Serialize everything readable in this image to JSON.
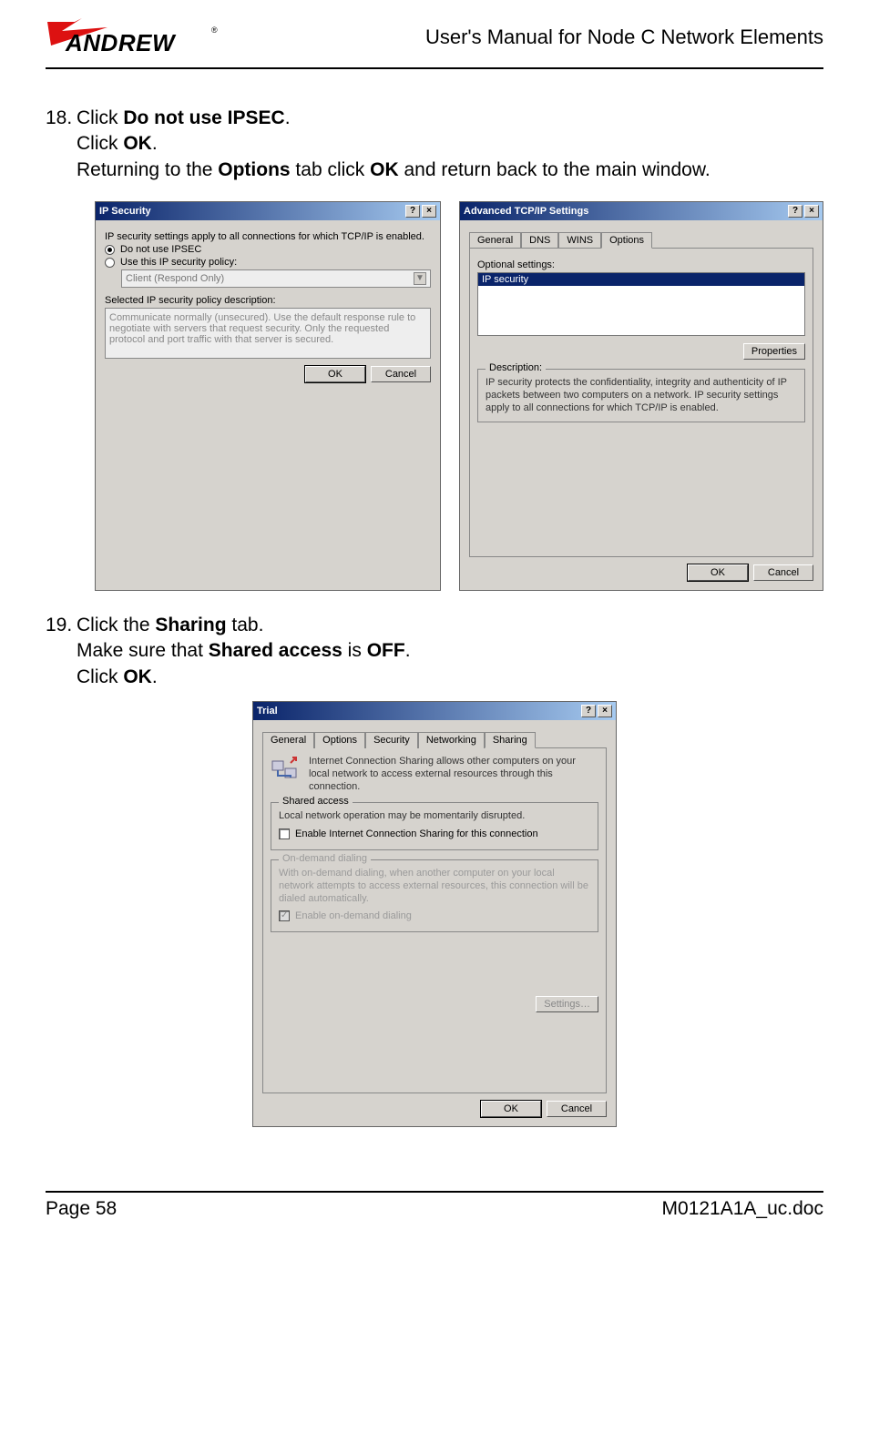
{
  "header": {
    "logo_text": "ANDREW",
    "manual_title": "User's Manual for Node C Network Elements"
  },
  "steps": {
    "s18": {
      "num": "18.",
      "l1a": "Click ",
      "l1b": "Do not use IPSEC",
      "l1c": ".",
      "l2a": "Click ",
      "l2b": "OK",
      "l2c": ".",
      "l3a": "Returning to the ",
      "l3b": "Options",
      "l3c": " tab click ",
      "l3d": "OK",
      "l3e": " and return back to the main window."
    },
    "s19": {
      "num": "19.",
      "l1a": "Click the ",
      "l1b": "Sharing",
      "l1c": " tab.",
      "l2a": "Make sure that ",
      "l2b": "Shared access",
      "l2c": " is ",
      "l2d": "OFF",
      "l2e": ".",
      "l3a": "Click ",
      "l3b": "OK",
      "l3c": "."
    }
  },
  "dlg_ipsec": {
    "title": "IP Security",
    "intro": "IP security settings apply to all connections for which TCP/IP is enabled.",
    "r1": "Do not use IPSEC",
    "r2": "Use this IP security policy:",
    "dd": "Client (Respond Only)",
    "pol_label": "Selected IP security policy description:",
    "pol_desc": "Communicate normally (unsecured). Use the default response rule to negotiate with servers that request security. Only the requested protocol and port traffic with that server is secured.",
    "ok": "OK",
    "cancel": "Cancel"
  },
  "dlg_adv": {
    "title": "Advanced TCP/IP Settings",
    "tabs": {
      "general": "General",
      "dns": "DNS",
      "wins": "WINS",
      "options": "Options"
    },
    "opt_label": "Optional settings:",
    "opt_item": "IP security",
    "props_btn": "Properties",
    "desc_title": "Description:",
    "desc_text": "IP security protects the confidentiality, integrity and authenticity of IP packets between two computers on a network. IP security settings apply to all connections for which TCP/IP is enabled.",
    "ok": "OK",
    "cancel": "Cancel"
  },
  "dlg_trial": {
    "title": "Trial",
    "tabs": {
      "general": "General",
      "options": "Options",
      "security": "Security",
      "networking": "Networking",
      "sharing": "Sharing"
    },
    "info": "Internet Connection Sharing allows other computers on your local network to access external resources through this connection.",
    "grp_shared": "Shared access",
    "shared_line": "Local network operation may be momentarily disrupted.",
    "chk_enable": "Enable Internet Connection Sharing for this connection",
    "grp_od": "On-demand dialing",
    "od_text": "With on-demand dialing, when another computer on your local network attempts to access external resources, this connection will be dialed automatically.",
    "chk_od": "Enable on-demand dialing",
    "settings_btn": "Settings…",
    "ok": "OK",
    "cancel": "Cancel"
  },
  "footer": {
    "page": "Page 58",
    "doc": "M0121A1A_uc.doc"
  },
  "glyph": {
    "help": "?",
    "close": "×",
    "down": "▼",
    "check": "✓"
  }
}
